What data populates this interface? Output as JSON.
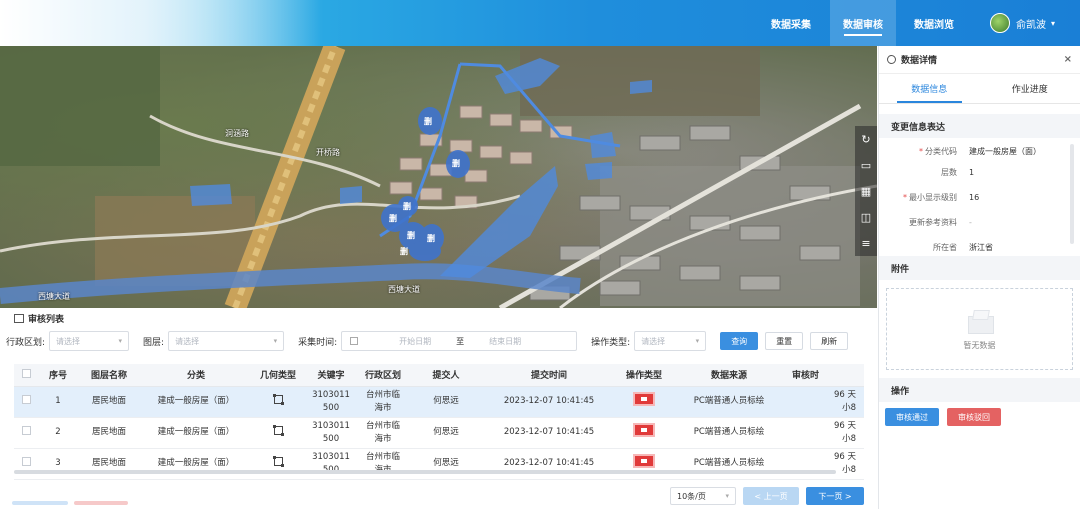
{
  "header": {
    "nav": [
      {
        "label": "数据采集",
        "active": false
      },
      {
        "label": "数据审核",
        "active": true
      },
      {
        "label": "数据浏览",
        "active": false
      }
    ],
    "user": {
      "name": "俞凯波",
      "caret": "▾"
    }
  },
  "map": {
    "labels": [
      "洞涵路",
      "开桥路",
      "西塘大道",
      "西塘大道"
    ],
    "markers": [
      "删",
      "删",
      "删",
      "删",
      "删",
      "删",
      "删"
    ],
    "tools": [
      "↻",
      "▭",
      "▦",
      "◫",
      "≡"
    ],
    "icons": [
      "refresh-icon",
      "layers-icon",
      "grid-icon",
      "split-icon",
      "menu-icon"
    ]
  },
  "panel": {
    "title": "数据详情",
    "close": "×",
    "tabs": [
      {
        "label": "数据信息",
        "active": true
      },
      {
        "label": "作业进度",
        "active": false
      }
    ],
    "change_section": "变更信息表达",
    "fields": [
      {
        "key": "分类代码",
        "required": true,
        "value": "建成一般房屋（面）",
        "muted": false
      },
      {
        "key": "层数",
        "required": false,
        "value": "1",
        "muted": false
      },
      {
        "key": "最小显示级别",
        "required": true,
        "value": "16",
        "muted": false
      },
      {
        "key": "更新参考资料",
        "required": false,
        "value": "-",
        "muted": true
      },
      {
        "key": "所在省",
        "required": false,
        "value": "浙江省",
        "muted": false
      }
    ],
    "attach_section": "附件",
    "empty_text": "暂无数据",
    "ops_section": "操作",
    "approve_label": "审核通过",
    "reject_label": "审核驳回"
  },
  "list": {
    "title": "审核列表",
    "filters": {
      "region_label": "行政区划:",
      "region_placeholder": "请选择",
      "layer_label": "图层:",
      "layer_placeholder": "请选择",
      "time_label": "采集时间:",
      "start_placeholder": "开始日期",
      "range_sep": "至",
      "end_placeholder": "结束日期",
      "optype_label": "操作类型:",
      "optype_placeholder": "请选择",
      "query_label": "查询",
      "reset_label": "重置",
      "refresh_label": "刷新"
    },
    "columns": [
      "序号",
      "图层名称",
      "分类",
      "几何类型",
      "关键字",
      "行政区划",
      "提交人",
      "提交时间",
      "操作类型",
      "数据来源",
      "审核时"
    ],
    "rows": [
      {
        "no": "1",
        "layer": "居民地面",
        "category": "建成一般房屋（面）",
        "keyword": "3103011\n500",
        "region": "台州市临\n海市",
        "submitter": "何思远",
        "time": "2023-12-07 10:41:45",
        "source": "PC端普通人员标绘",
        "audit": "96 天\n小8",
        "selected": true
      },
      {
        "no": "2",
        "layer": "居民地面",
        "category": "建成一般房屋（面）",
        "keyword": "3103011\n500",
        "region": "台州市临\n海市",
        "submitter": "何思远",
        "time": "2023-12-07 10:41:45",
        "source": "PC端普通人员标绘",
        "audit": "96 天\n小8",
        "selected": false
      },
      {
        "no": "3",
        "layer": "居民地面",
        "category": "建成一般房屋（面）",
        "keyword": "3103011\n500",
        "region": "台州市临\n海市",
        "submitter": "何思远",
        "time": "2023-12-07 10:41:45",
        "source": "PC端普通人员标绘",
        "audit": "96 天\n小8",
        "selected": false
      }
    ],
    "pager": {
      "page_size": "10条/页",
      "prev_label": "< 上一页",
      "next_label": "下一页 >"
    }
  },
  "colors": {
    "accent": "#2a86dd",
    "danger": "#e46262",
    "selected_row": "#e3effb",
    "polygon": "#4f8be0"
  }
}
